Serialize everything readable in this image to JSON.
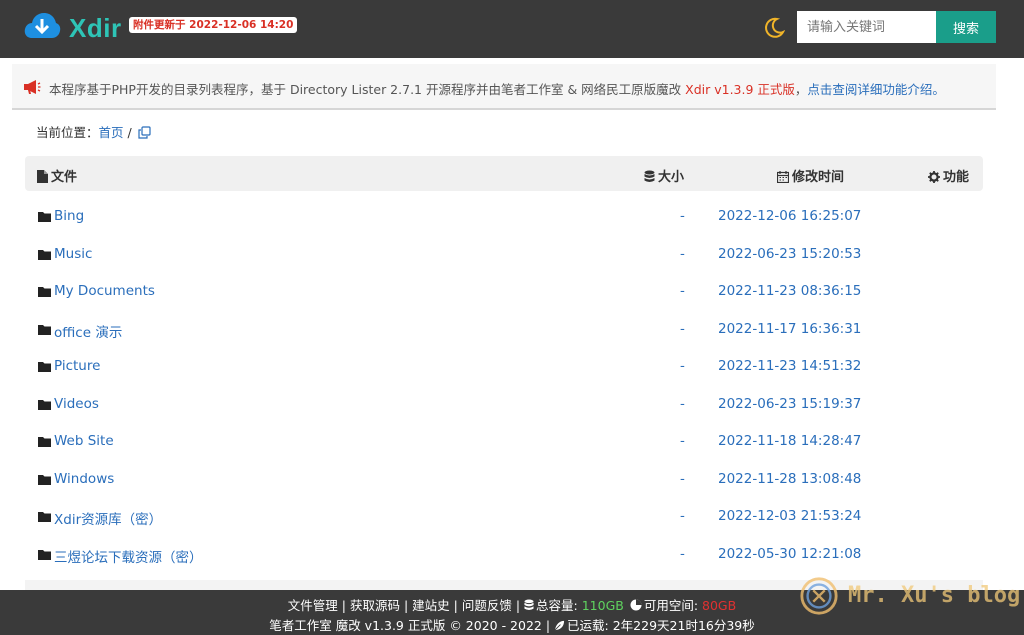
{
  "header": {
    "brand": "Xdir",
    "update_badge": "附件更新于 2022-12-06 14:20",
    "search_placeholder": "请输入关键词",
    "search_button": "搜索",
    "colors": {
      "bar": "#3a3a3a",
      "brand": "#2ec4b6",
      "accent": "#1a9e8a"
    },
    "icons": [
      "cloud-download-icon",
      "moon-icon"
    ]
  },
  "notice": {
    "text_prefix": "本程序基于PHP开发的目录列表程序，基于 Directory Lister 2.7.1 开源程序并由笔者工作室 & 网络民工原版魔改 ",
    "version": "Xdir v1.3.9 正式版",
    "separator": "，",
    "link": "点击查阅详细功能介绍。",
    "icon": "megaphone-icon"
  },
  "breadcrumb": {
    "label": "当前位置：",
    "home": "首页",
    "separator": "/",
    "icon": "copy-icon"
  },
  "table": {
    "headers": {
      "name": "文件",
      "size": "大小",
      "time": "修改时间",
      "actions": "功能"
    },
    "rows": [
      {
        "name": "Bing",
        "size": "-",
        "time": "2022-12-06 16:25:07"
      },
      {
        "name": "Music",
        "size": "-",
        "time": "2022-06-23 15:20:53"
      },
      {
        "name": "My Documents",
        "size": "-",
        "time": "2022-11-23 08:36:15"
      },
      {
        "name": "office 演示",
        "size": "-",
        "time": "2022-11-17 16:36:31"
      },
      {
        "name": "Picture",
        "size": "-",
        "time": "2022-11-23 14:51:32"
      },
      {
        "name": "Videos",
        "size": "-",
        "time": "2022-06-23 15:19:37"
      },
      {
        "name": "Web Site",
        "size": "-",
        "time": "2022-11-18 14:28:47"
      },
      {
        "name": "Windows",
        "size": "-",
        "time": "2022-11-28 13:08:48"
      },
      {
        "name": "Xdir资源库（密）",
        "size": "-",
        "time": "2022-12-03 21:53:24"
      },
      {
        "name": "三煜论坛下载资源（密）",
        "size": "-",
        "time": "2022-05-30 12:21:08"
      }
    ]
  },
  "footer": {
    "links": [
      "文件管理",
      "获取源码",
      "建站史",
      "问题反馈"
    ],
    "sep": " | ",
    "total_label": "总容量: ",
    "total_value": "110GB",
    "free_label": "可用空间: ",
    "free_value": "80GB",
    "copyright": "笔者工作室 魔改 v1.3.9 正式版 © 2020 - 2022 | ",
    "uptime_label": "已运载:",
    "uptime_value": "2年229天21时16分39秒"
  },
  "watermark": {
    "text": "Mr. Xu's blog"
  }
}
